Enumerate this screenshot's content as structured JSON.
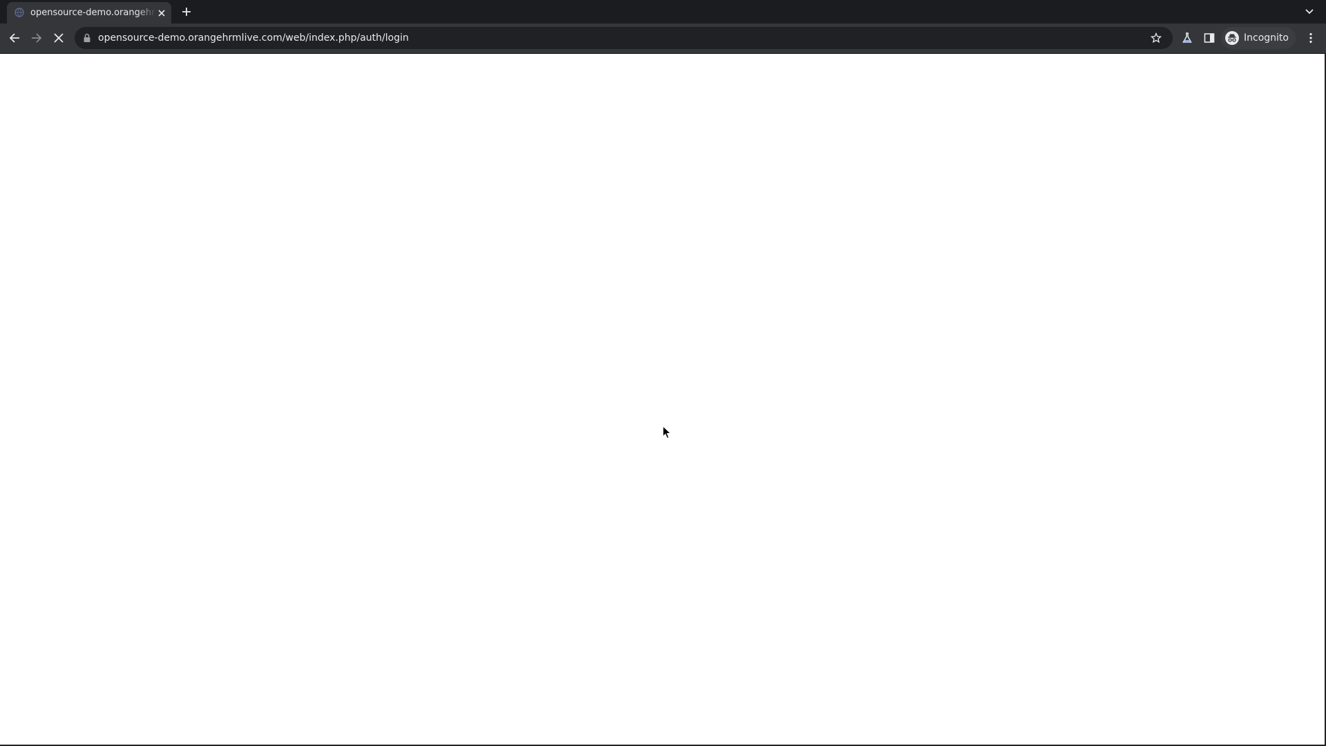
{
  "browser": {
    "tab": {
      "title": "opensource-demo.orangehrmlive.com/web/index.php/auth/login",
      "favicon": "globe-icon"
    },
    "toolbar": {
      "url": "opensource-demo.orangehrmlive.com/web/index.php/auth/login",
      "back_icon": "back-arrow-icon",
      "forward_icon": "forward-arrow-icon",
      "stop_icon": "stop-loading-icon",
      "lock_icon": "lock-icon",
      "bookmark_icon": "star-icon",
      "labs_icon": "flask-icon",
      "side_panel_icon": "side-panel-icon",
      "profile_label": "Incognito",
      "profile_icon": "incognito-icon",
      "menu_icon": "kebab-menu-icon"
    }
  },
  "page": {
    "state": "loading",
    "background": "#ffffff"
  },
  "colors": {
    "frame": "#202124",
    "toolbar": "#35363a",
    "text": "#e8eaed"
  }
}
